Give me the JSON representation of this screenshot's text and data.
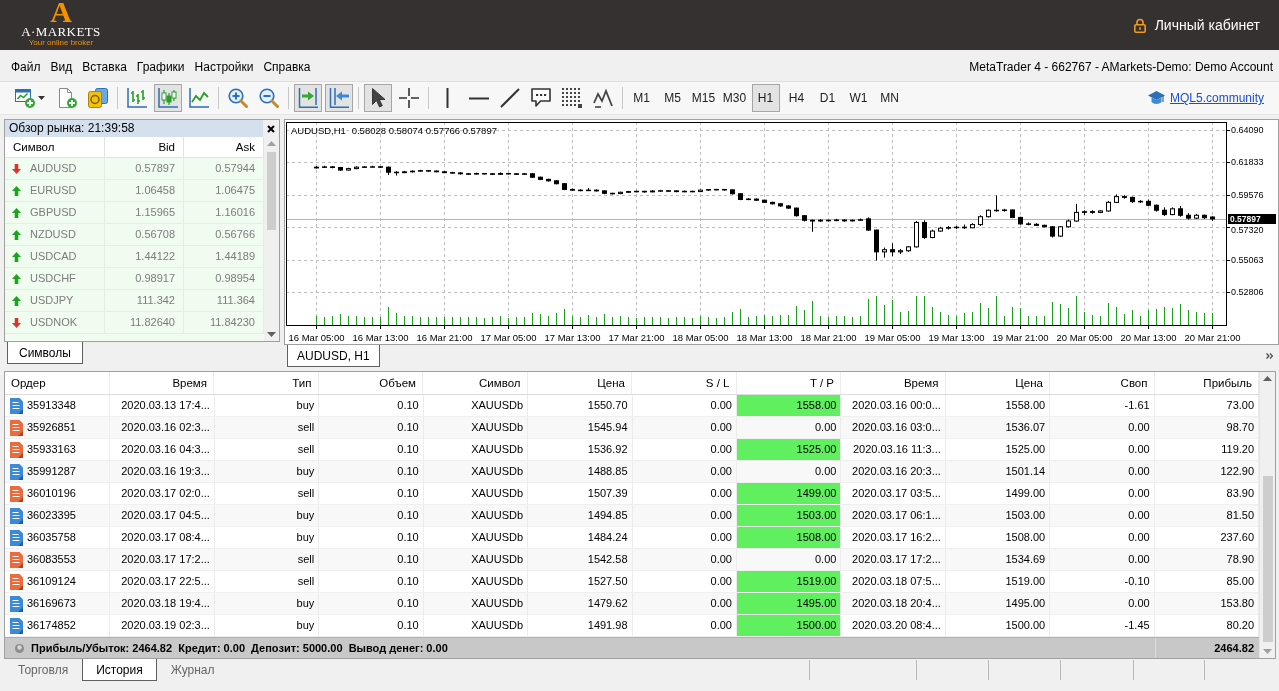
{
  "header": {
    "logo": {
      "mark": "A",
      "name": "A·MARKETS",
      "tagline": "Your online broker"
    },
    "account_link": "Личный кабинет"
  },
  "menubar": {
    "items": [
      "Файл",
      "Вид",
      "Вставка",
      "Графики",
      "Настройки",
      "Справка"
    ],
    "window_title": "MetaTrader 4 - 662767 - AMarkets-Demo: Demo Account"
  },
  "toolbar": {
    "groups": [
      {
        "tools": [
          {
            "kind": "newchart",
            "pressed": false
          },
          {
            "kind": "profile",
            "pressed": false
          },
          {
            "kind": "coins",
            "pressed": false
          }
        ]
      },
      {
        "tools": [
          {
            "kind": "bars",
            "pressed": false
          },
          {
            "kind": "candles",
            "pressed": true
          },
          {
            "kind": "line",
            "pressed": false
          }
        ]
      },
      {
        "tools": [
          {
            "kind": "zoomin",
            "pressed": false
          },
          {
            "kind": "zoomout",
            "pressed": false
          }
        ]
      },
      {
        "tools": [
          {
            "kind": "shift",
            "pressed": true
          },
          {
            "kind": "autoscroll",
            "pressed": true
          }
        ]
      },
      {
        "tools": [
          {
            "kind": "cursor",
            "pressed": true
          },
          {
            "kind": "crosshair",
            "pressed": false
          }
        ]
      },
      {
        "tools": [
          {
            "kind": "vline",
            "pressed": false
          },
          {
            "kind": "hline",
            "pressed": false
          },
          {
            "kind": "trend",
            "pressed": false
          },
          {
            "kind": "comment",
            "pressed": false
          },
          {
            "kind": "fibo",
            "pressed": false
          },
          {
            "kind": "waves",
            "pressed": false
          }
        ]
      }
    ],
    "timeframes": [
      {
        "label": "M1",
        "selected": false
      },
      {
        "label": "M5",
        "selected": false
      },
      {
        "label": "M15",
        "selected": false
      },
      {
        "label": "M30",
        "selected": false
      },
      {
        "label": "H1",
        "selected": true
      },
      {
        "label": "H4",
        "selected": false
      },
      {
        "label": "D1",
        "selected": false
      },
      {
        "label": "W1",
        "selected": false
      },
      {
        "label": "MN",
        "selected": false
      }
    ],
    "community_link": "MQL5.community"
  },
  "market_watch": {
    "title": "Обзор рынка: 21:39:58",
    "columns": [
      "Символ",
      "Bid",
      "Ask"
    ],
    "rows": [
      {
        "symbol": "AUDUSD",
        "bid": "0.57897",
        "ask": "0.57944",
        "kind": "down"
      },
      {
        "symbol": "EURUSD",
        "bid": "1.06458",
        "ask": "1.06475",
        "kind": "up"
      },
      {
        "symbol": "GBPUSD",
        "bid": "1.15965",
        "ask": "1.16016",
        "kind": "up"
      },
      {
        "symbol": "NZDUSD",
        "bid": "0.56708",
        "ask": "0.56766",
        "kind": "up"
      },
      {
        "symbol": "USDCAD",
        "bid": "1.44122",
        "ask": "1.44189",
        "kind": "up"
      },
      {
        "symbol": "USDCHF",
        "bid": "0.98917",
        "ask": "0.98954",
        "kind": "up"
      },
      {
        "symbol": "USDJPY",
        "bid": "111.342",
        "ask": "111.364",
        "kind": "up"
      },
      {
        "symbol": "USDNOK",
        "bid": "11.82640",
        "ask": "11.84230",
        "kind": "down"
      }
    ],
    "tabs": [
      {
        "label": "Символы",
        "selected": true
      }
    ]
  },
  "chart": {
    "tabs": [
      {
        "label": "AUDUSD, H1",
        "selected": true
      }
    ],
    "chart_data": [
      {
        "type": "candlestick",
        "title": "AUDUSD,H1",
        "annotations": [
          "0.58028 0.58074 0.57766 0.57897"
        ],
        "grid": true,
        "ylim": [
          0.50507,
          0.64647
        ],
        "yticks": [
          {
            "value": 0.52806,
            "label": "0.52806"
          },
          {
            "value": 0.55063,
            "label": "0.55063"
          },
          {
            "value": 0.5732,
            "label": "0.57320"
          },
          {
            "value": 0.59576,
            "label": "0.59576"
          },
          {
            "value": 0.61833,
            "label": "0.61833"
          },
          {
            "value": 0.6409,
            "label": "0.64090"
          }
        ],
        "ref_lines": [
          {
            "axis": "y",
            "value": 0.57897,
            "label": "0.57897"
          }
        ],
        "categories": [
          "16 Mar 05:00",
          null,
          null,
          null,
          null,
          null,
          null,
          null,
          "16 Mar 13:00",
          null,
          null,
          null,
          null,
          null,
          null,
          null,
          "16 Mar 21:00",
          null,
          null,
          null,
          null,
          null,
          null,
          null,
          "17 Mar 05:00",
          null,
          null,
          null,
          null,
          null,
          null,
          null,
          "17 Mar 13:00",
          null,
          null,
          null,
          null,
          null,
          null,
          null,
          "17 Mar 21:00",
          null,
          null,
          null,
          null,
          null,
          null,
          null,
          "18 Mar 05:00",
          null,
          null,
          null,
          null,
          null,
          null,
          null,
          "18 Mar 13:00",
          null,
          null,
          null,
          null,
          null,
          null,
          null,
          "18 Mar 21:00",
          null,
          null,
          null,
          null,
          null,
          null,
          null,
          "19 Mar 05:00",
          null,
          null,
          null,
          null,
          null,
          null,
          null,
          "19 Mar 13:00",
          null,
          null,
          null,
          null,
          null,
          null,
          null,
          "19 Mar 21:00",
          null,
          null,
          null,
          null,
          null,
          null,
          null,
          "20 Mar 05:00",
          null,
          null,
          null,
          null,
          null,
          null,
          null,
          "20 Mar 13:00",
          null,
          null,
          null,
          null,
          null,
          null,
          null,
          "20 Mar 21:00"
        ],
        "ohlc": [
          [
            0.6145,
            0.6158,
            0.614,
            0.615
          ],
          [
            0.615,
            0.616,
            0.6145,
            0.6152
          ],
          [
            0.6152,
            0.6158,
            0.6142,
            0.6148
          ],
          [
            0.6148,
            0.6152,
            0.6125,
            0.613
          ],
          [
            0.613,
            0.6146,
            0.6126,
            0.614
          ],
          [
            0.614,
            0.6156,
            0.6136,
            0.615
          ],
          [
            0.615,
            0.6158,
            0.6146,
            0.6152
          ],
          [
            0.6152,
            0.616,
            0.6148,
            0.6153
          ],
          [
            0.6153,
            0.6158,
            0.6145,
            0.615
          ],
          [
            0.615,
            0.6155,
            0.6095,
            0.6115
          ],
          [
            0.6115,
            0.6122,
            0.6092,
            0.6112
          ],
          [
            0.6112,
            0.6124,
            0.6108,
            0.6118
          ],
          [
            0.6118,
            0.6128,
            0.6112,
            0.6122
          ],
          [
            0.6122,
            0.6132,
            0.6118,
            0.6126
          ],
          [
            0.6126,
            0.613,
            0.6118,
            0.6123
          ],
          [
            0.6123,
            0.6128,
            0.6114,
            0.6118
          ],
          [
            0.6118,
            0.6122,
            0.6108,
            0.6112
          ],
          [
            0.6112,
            0.6118,
            0.6106,
            0.611
          ],
          [
            0.611,
            0.6114,
            0.6099,
            0.6104
          ],
          [
            0.6104,
            0.611,
            0.6097,
            0.6102
          ],
          [
            0.6102,
            0.6112,
            0.6098,
            0.6106
          ],
          [
            0.6106,
            0.611,
            0.61,
            0.6104
          ],
          [
            0.6104,
            0.6108,
            0.6095,
            0.61
          ],
          [
            0.61,
            0.6114,
            0.6097,
            0.6106
          ],
          [
            0.6106,
            0.611,
            0.61,
            0.6104
          ],
          [
            0.6104,
            0.6108,
            0.6096,
            0.61
          ],
          [
            0.61,
            0.611,
            0.6097,
            0.6104
          ],
          [
            0.6104,
            0.6108,
            0.6075,
            0.608
          ],
          [
            0.608,
            0.6085,
            0.606,
            0.6065
          ],
          [
            0.6065,
            0.607,
            0.605,
            0.6055
          ],
          [
            0.6055,
            0.606,
            0.603,
            0.6035
          ],
          [
            0.6035,
            0.604,
            0.599,
            0.5995
          ],
          [
            0.5995,
            0.6,
            0.5984,
            0.599
          ],
          [
            0.599,
            0.5996,
            0.5982,
            0.5988
          ],
          [
            0.5988,
            0.6005,
            0.5984,
            0.599
          ],
          [
            0.599,
            0.5995,
            0.598,
            0.5985
          ],
          [
            0.5985,
            0.5988,
            0.5962,
            0.5968
          ],
          [
            0.5968,
            0.5972,
            0.596,
            0.5966
          ],
          [
            0.5966,
            0.598,
            0.5962,
            0.5975
          ],
          [
            0.5975,
            0.5985,
            0.597,
            0.598
          ],
          [
            0.598,
            0.5986,
            0.5975,
            0.5982
          ],
          [
            0.5982,
            0.5985,
            0.5972,
            0.5978
          ],
          [
            0.5978,
            0.599,
            0.5975,
            0.5984
          ],
          [
            0.5984,
            0.5992,
            0.598,
            0.5986
          ],
          [
            0.5986,
            0.599,
            0.598,
            0.5985
          ],
          [
            0.5985,
            0.5988,
            0.5975,
            0.598
          ],
          [
            0.598,
            0.5988,
            0.5976,
            0.5982
          ],
          [
            0.5982,
            0.5986,
            0.5976,
            0.598
          ],
          [
            0.598,
            0.5995,
            0.5977,
            0.599
          ],
          [
            0.599,
            0.5998,
            0.5986,
            0.5994
          ],
          [
            0.5994,
            0.5999,
            0.599,
            0.5995
          ],
          [
            0.5995,
            0.5998,
            0.5986,
            0.5992
          ],
          [
            0.5992,
            0.5995,
            0.596,
            0.5965
          ],
          [
            0.5965,
            0.5968,
            0.592,
            0.5925
          ],
          [
            0.5925,
            0.5934,
            0.592,
            0.5928
          ],
          [
            0.5928,
            0.5932,
            0.5915,
            0.592
          ],
          [
            0.592,
            0.5924,
            0.59,
            0.5905
          ],
          [
            0.5905,
            0.591,
            0.589,
            0.5895
          ],
          [
            0.5895,
            0.59,
            0.5875,
            0.588
          ],
          [
            0.588,
            0.5884,
            0.586,
            0.5865
          ],
          [
            0.5865,
            0.5868,
            0.5806,
            0.5812
          ],
          [
            0.5812,
            0.5816,
            0.5772,
            0.578
          ],
          [
            0.578,
            0.5786,
            0.57,
            0.5775
          ],
          [
            0.5775,
            0.5788,
            0.577,
            0.578
          ],
          [
            0.578,
            0.5785,
            0.5772,
            0.5778
          ],
          [
            0.5778,
            0.579,
            0.5774,
            0.5782
          ],
          [
            0.5782,
            0.5786,
            0.577,
            0.5776
          ],
          [
            0.5776,
            0.5786,
            0.5772,
            0.578
          ],
          [
            0.578,
            0.5792,
            0.5776,
            0.5784
          ],
          [
            0.579,
            0.58,
            0.5705,
            0.5712
          ],
          [
            0.5712,
            0.5715,
            0.55,
            0.556
          ],
          [
            0.556,
            0.559,
            0.552,
            0.5575
          ],
          [
            0.5575,
            0.562,
            0.553,
            0.556
          ],
          [
            0.556,
            0.558,
            0.5545,
            0.5568
          ],
          [
            0.5568,
            0.56,
            0.556,
            0.5595
          ],
          [
            0.5595,
            0.5775,
            0.559,
            0.5765
          ],
          [
            0.5765,
            0.578,
            0.565,
            0.566
          ],
          [
            0.566,
            0.5715,
            0.5655,
            0.5705
          ],
          [
            0.5705,
            0.5735,
            0.57,
            0.5725
          ],
          [
            0.5725,
            0.574,
            0.5715,
            0.573
          ],
          [
            0.573,
            0.574,
            0.572,
            0.5732
          ],
          [
            0.5732,
            0.575,
            0.572,
            0.5728
          ],
          [
            0.5728,
            0.576,
            0.5725,
            0.575
          ],
          [
            0.575,
            0.5815,
            0.574,
            0.5805
          ],
          [
            0.5805,
            0.5855,
            0.58,
            0.585
          ],
          [
            0.585,
            0.5953,
            0.584,
            0.5848
          ],
          [
            0.5848,
            0.586,
            0.584,
            0.5852
          ],
          [
            0.5852,
            0.5855,
            0.5795,
            0.58
          ],
          [
            0.58,
            0.5805,
            0.575,
            0.5755
          ],
          [
            0.5755,
            0.5765,
            0.5745,
            0.5752
          ],
          [
            0.5752,
            0.576,
            0.574,
            0.5745
          ],
          [
            0.5745,
            0.575,
            0.573,
            0.5735
          ],
          [
            0.5735,
            0.574,
            0.566,
            0.567
          ],
          [
            0.567,
            0.574,
            0.5665,
            0.5735
          ],
          [
            0.5735,
            0.5785,
            0.573,
            0.5775
          ],
          [
            0.5775,
            0.5895,
            0.577,
            0.5835
          ],
          [
            0.5835,
            0.585,
            0.5815,
            0.584
          ],
          [
            0.584,
            0.585,
            0.5825,
            0.5835
          ],
          [
            0.5835,
            0.585,
            0.583,
            0.5845
          ],
          [
            0.5845,
            0.5915,
            0.584,
            0.5905
          ],
          [
            0.5905,
            0.596,
            0.59,
            0.5945
          ],
          [
            0.5945,
            0.5955,
            0.593,
            0.594
          ],
          [
            0.594,
            0.5945,
            0.59,
            0.591
          ],
          [
            0.591,
            0.592,
            0.59,
            0.5912
          ],
          [
            0.5912,
            0.5925,
            0.588,
            0.5885
          ],
          [
            0.5885,
            0.589,
            0.584,
            0.585
          ],
          [
            0.585,
            0.587,
            0.581,
            0.582
          ],
          [
            0.582,
            0.587,
            0.5815,
            0.586
          ],
          [
            0.586,
            0.588,
            0.5805,
            0.5815
          ],
          [
            0.5815,
            0.583,
            0.5785,
            0.5795
          ],
          [
            0.5795,
            0.5825,
            0.579,
            0.5815
          ],
          [
            0.5815,
            0.582,
            0.579,
            0.5798
          ],
          [
            0.58028,
            0.58074,
            0.57766,
            0.57897
          ]
        ]
      }
    ]
  },
  "terminal": {
    "columns": [
      "Ордер",
      "Время",
      "Тип",
      "Объем",
      "Символ",
      "Цена",
      "S / L",
      "T / P",
      "Время",
      "Цена",
      "Своп",
      "Прибыль"
    ],
    "rows": [
      {
        "order": "35913348",
        "kind": "buy",
        "open_time": "2020.03.13 17:4...",
        "type": "buy",
        "volume": "0.10",
        "symbol": "XAUUSDb",
        "open_price": "1550.70",
        "sl": "0.00",
        "tp": "1558.00",
        "tp_hit": true,
        "close_time": "2020.03.16 00:0...",
        "close_price": "1558.00",
        "swap": "-1.61",
        "profit": "73.00"
      },
      {
        "order": "35926851",
        "kind": "sell",
        "open_time": "2020.03.16 02:3...",
        "type": "sell",
        "volume": "0.10",
        "symbol": "XAUUSDb",
        "open_price": "1545.94",
        "sl": "0.00",
        "tp": "0.00",
        "tp_hit": false,
        "close_time": "2020.03.16 03:0...",
        "close_price": "1536.07",
        "swap": "0.00",
        "profit": "98.70"
      },
      {
        "order": "35933163",
        "kind": "sell",
        "open_time": "2020.03.16 04:3...",
        "type": "sell",
        "volume": "0.10",
        "symbol": "XAUUSDb",
        "open_price": "1536.92",
        "sl": "0.00",
        "tp": "1525.00",
        "tp_hit": true,
        "close_time": "2020.03.16 11:3...",
        "close_price": "1525.00",
        "swap": "0.00",
        "profit": "119.20"
      },
      {
        "order": "35991287",
        "kind": "buy",
        "open_time": "2020.03.16 19:3...",
        "type": "buy",
        "volume": "0.10",
        "symbol": "XAUUSDb",
        "open_price": "1488.85",
        "sl": "0.00",
        "tp": "0.00",
        "tp_hit": false,
        "close_time": "2020.03.16 20:3...",
        "close_price": "1501.14",
        "swap": "0.00",
        "profit": "122.90"
      },
      {
        "order": "36010196",
        "kind": "sell",
        "open_time": "2020.03.17 02:0...",
        "type": "sell",
        "volume": "0.10",
        "symbol": "XAUUSDb",
        "open_price": "1507.39",
        "sl": "0.00",
        "tp": "1499.00",
        "tp_hit": true,
        "close_time": "2020.03.17 03:5...",
        "close_price": "1499.00",
        "swap": "0.00",
        "profit": "83.90"
      },
      {
        "order": "36023395",
        "kind": "buy",
        "open_time": "2020.03.17 04:5...",
        "type": "buy",
        "volume": "0.10",
        "symbol": "XAUUSDb",
        "open_price": "1494.85",
        "sl": "0.00",
        "tp": "1503.00",
        "tp_hit": true,
        "close_time": "2020.03.17 06:1...",
        "close_price": "1503.00",
        "swap": "0.00",
        "profit": "81.50"
      },
      {
        "order": "36035758",
        "kind": "buy",
        "open_time": "2020.03.17 08:4...",
        "type": "buy",
        "volume": "0.10",
        "symbol": "XAUUSDb",
        "open_price": "1484.24",
        "sl": "0.00",
        "tp": "1508.00",
        "tp_hit": true,
        "close_time": "2020.03.17 16:2...",
        "close_price": "1508.00",
        "swap": "0.00",
        "profit": "237.60"
      },
      {
        "order": "36083553",
        "kind": "sell",
        "open_time": "2020.03.17 17:2...",
        "type": "sell",
        "volume": "0.10",
        "symbol": "XAUUSDb",
        "open_price": "1542.58",
        "sl": "0.00",
        "tp": "0.00",
        "tp_hit": false,
        "close_time": "2020.03.17 17:2...",
        "close_price": "1534.69",
        "swap": "0.00",
        "profit": "78.90"
      },
      {
        "order": "36109124",
        "kind": "sell",
        "open_time": "2020.03.17 22:5...",
        "type": "sell",
        "volume": "0.10",
        "symbol": "XAUUSDb",
        "open_price": "1527.50",
        "sl": "0.00",
        "tp": "1519.00",
        "tp_hit": true,
        "close_time": "2020.03.18 07:5...",
        "close_price": "1519.00",
        "swap": "-0.10",
        "profit": "85.00"
      },
      {
        "order": "36169673",
        "kind": "buy",
        "open_time": "2020.03.18 19:4...",
        "type": "buy",
        "volume": "0.10",
        "symbol": "XAUUSDb",
        "open_price": "1479.62",
        "sl": "0.00",
        "tp": "1495.00",
        "tp_hit": true,
        "close_time": "2020.03.18 20:4...",
        "close_price": "1495.00",
        "swap": "0.00",
        "profit": "153.80"
      },
      {
        "order": "36174852",
        "kind": "buy",
        "open_time": "2020.03.19 02:3...",
        "type": "buy",
        "volume": "0.10",
        "symbol": "XAUUSDb",
        "open_price": "1491.98",
        "sl": "0.00",
        "tp": "1500.00",
        "tp_hit": true,
        "close_time": "2020.03.20 08:4...",
        "close_price": "1500.00",
        "swap": "-1.45",
        "profit": "80.20"
      }
    ],
    "summary": {
      "text": "Прибыль/Убыток: 2464.82  Кредит: 0.00  Депозит: 5000.00  Вывод денег: 0.00",
      "total": "2464.82"
    },
    "tabs": [
      {
        "label": "Торговля",
        "selected": false
      },
      {
        "label": "История",
        "selected": true
      },
      {
        "label": "Журнал",
        "selected": false
      }
    ]
  }
}
